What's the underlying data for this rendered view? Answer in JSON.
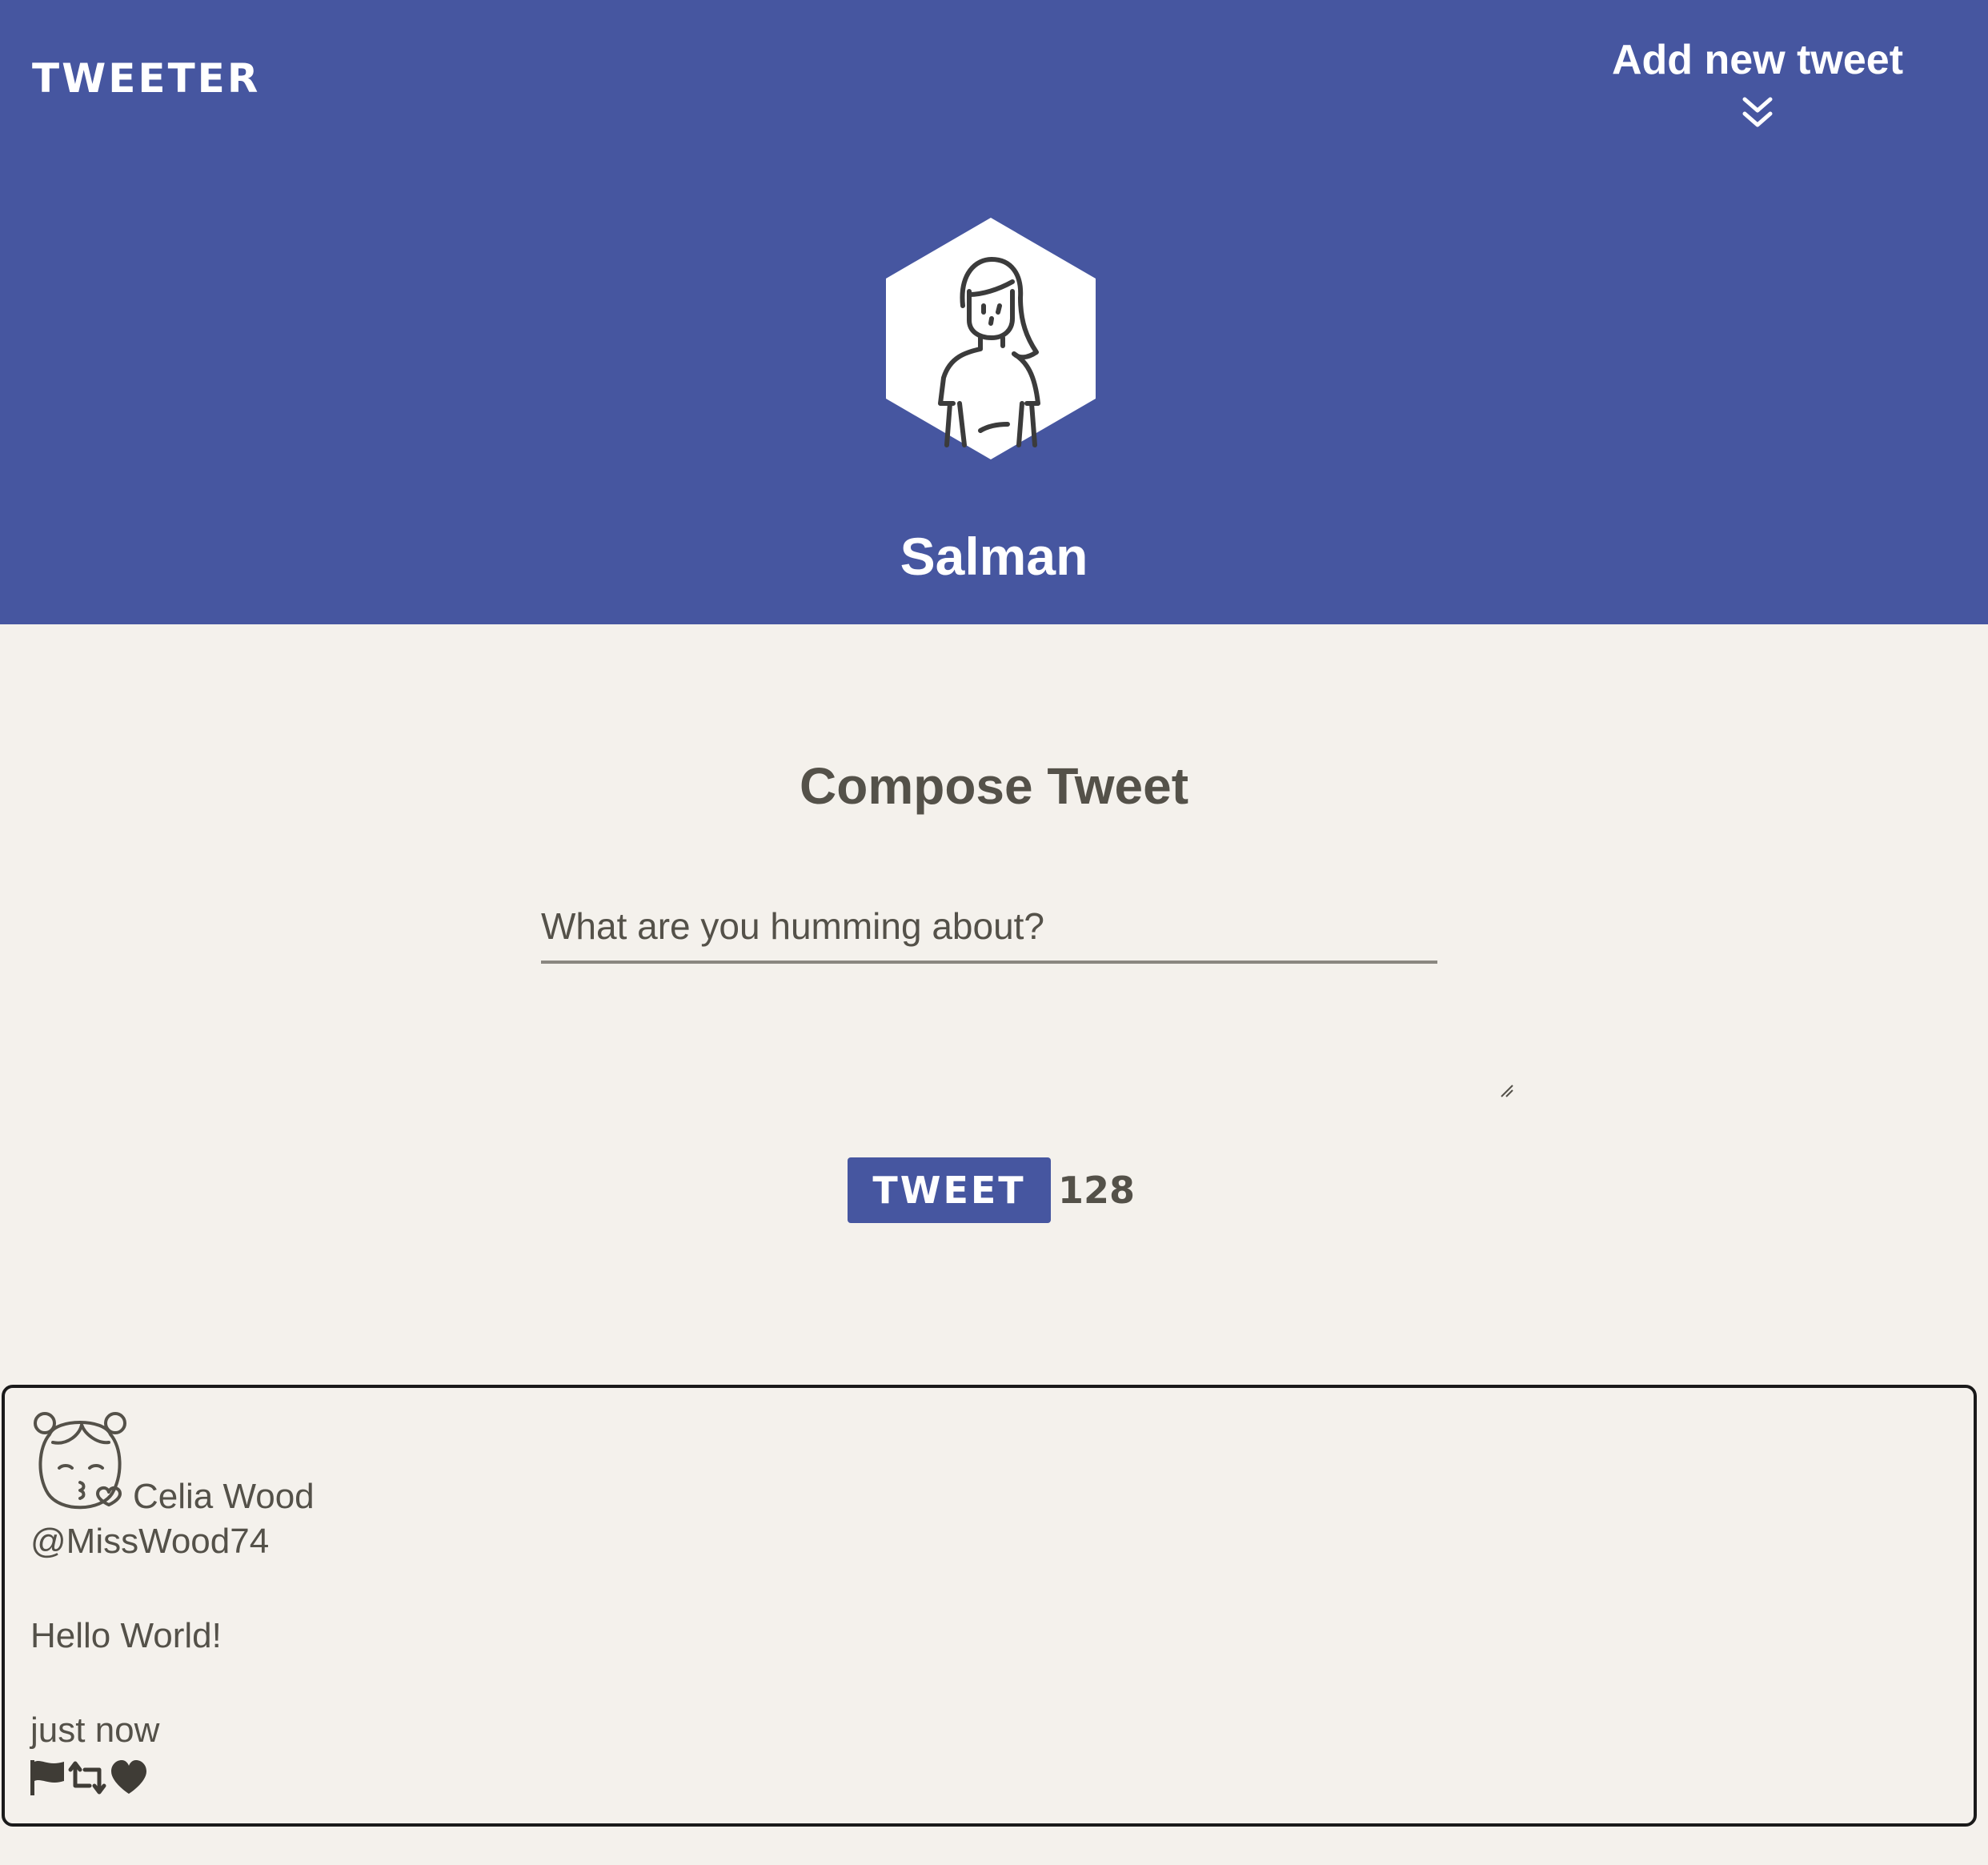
{
  "header": {
    "brand": "TWEETER",
    "add_new_label": "Add new tweet",
    "profile_name": "Salman",
    "background_color": "#4656a0"
  },
  "compose": {
    "title": "Compose Tweet",
    "placeholder": "What are you humming about?",
    "value": "",
    "button_label": "TWEET",
    "char_count": "128"
  },
  "tweets": [
    {
      "author": "Celia Wood",
      "handle": "@MissWood74",
      "text": "Hello World!",
      "time": "just now",
      "actions": [
        "flag-icon",
        "retweet-icon",
        "heart-icon"
      ]
    }
  ],
  "colors": {
    "accent": "#4656a0",
    "page_bg": "#f4f1ec",
    "text": "#545149"
  }
}
